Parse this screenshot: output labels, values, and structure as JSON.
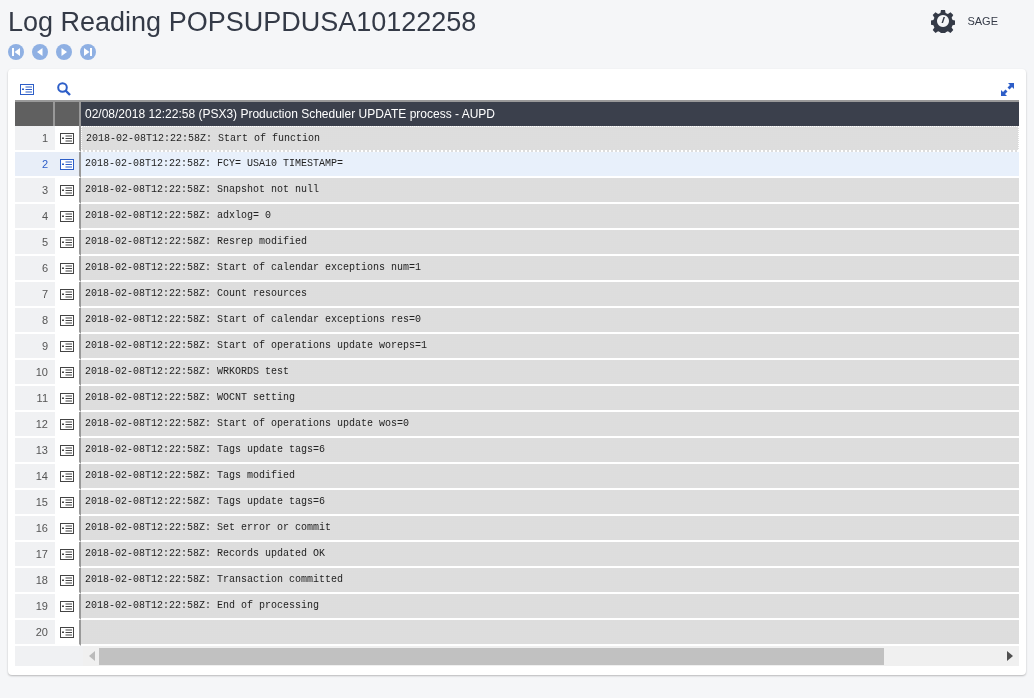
{
  "page_title": "Log Reading POPSUPDUSA10122258",
  "user": {
    "name": "SAGE"
  },
  "table": {
    "header": "02/08/2018 12:22:58 (PSX3) Production Scheduler UPDATE process - AUPD",
    "rows": [
      {
        "number": "1",
        "text": "2018-02-08T12:22:58Z: Start of function",
        "selected": false
      },
      {
        "number": "2",
        "text": "2018-02-08T12:22:58Z: FCY= USA10 TIMESTAMP=",
        "selected": true
      },
      {
        "number": "3",
        "text": "2018-02-08T12:22:58Z: Snapshot not null",
        "selected": false
      },
      {
        "number": "4",
        "text": "2018-02-08T12:22:58Z: adxlog= 0",
        "selected": false
      },
      {
        "number": "5",
        "text": "2018-02-08T12:22:58Z: Resrep modified",
        "selected": false
      },
      {
        "number": "6",
        "text": "2018-02-08T12:22:58Z: Start of calendar exceptions num=1",
        "selected": false
      },
      {
        "number": "7",
        "text": "2018-02-08T12:22:58Z: Count resources",
        "selected": false
      },
      {
        "number": "8",
        "text": "2018-02-08T12:22:58Z: Start of calendar exceptions res=0",
        "selected": false
      },
      {
        "number": "9",
        "text": "2018-02-08T12:22:58Z: Start of operations update woreps=1",
        "selected": false
      },
      {
        "number": "10",
        "text": "2018-02-08T12:22:58Z: WRKORDS test",
        "selected": false
      },
      {
        "number": "11",
        "text": "2018-02-08T12:22:58Z: WOCNT setting",
        "selected": false
      },
      {
        "number": "12",
        "text": "2018-02-08T12:22:58Z: Start of operations update wos=0",
        "selected": false
      },
      {
        "number": "13",
        "text": "2018-02-08T12:22:58Z: Tags update tags=6",
        "selected": false
      },
      {
        "number": "14",
        "text": "2018-02-08T12:22:58Z: Tags modified",
        "selected": false
      },
      {
        "number": "15",
        "text": "2018-02-08T12:22:58Z: Tags update tags=6",
        "selected": false
      },
      {
        "number": "16",
        "text": "2018-02-08T12:22:58Z: Set error or commit",
        "selected": false
      },
      {
        "number": "17",
        "text": "2018-02-08T12:22:58Z: Records updated OK",
        "selected": false
      },
      {
        "number": "18",
        "text": "2018-02-08T12:22:58Z: Transaction committed",
        "selected": false
      },
      {
        "number": "19",
        "text": "2018-02-08T12:22:58Z: End of processing",
        "selected": false
      },
      {
        "number": "20",
        "text": "",
        "selected": false
      }
    ]
  }
}
